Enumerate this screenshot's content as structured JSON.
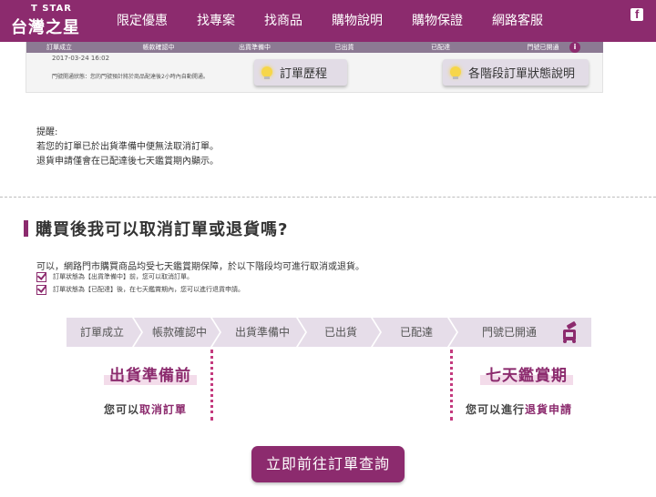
{
  "header": {
    "brand_small": "T STAR",
    "brand_main": "台灣之星",
    "nav": [
      "限定優惠",
      "找專案",
      "找商品",
      "購物說明",
      "購物保證",
      "網路客服"
    ],
    "facebook_icon": "facebook-icon"
  },
  "tracking_card": {
    "steps": [
      "訂單成立",
      "帳款確認中",
      "出貨準備中",
      "已出貨",
      "已配達",
      "門號已開通"
    ],
    "info_icon": "info-icon",
    "date": "2017-03-24 16:02",
    "note": "門號開通狀態：您的門號預計將於商品配達後2小時內自動開通。",
    "history_button": "訂單歷程",
    "stage_button": "各階段訂單狀態說明"
  },
  "reminder": {
    "title": "提醒:",
    "line1": "若您的訂單已於出貨準備中便無法取消訂單。",
    "line2": "退貨申請僅會在已配達後七天鑑賞期內顯示。"
  },
  "section": {
    "title": "購買後我可以取消訂單或退貨嗎?",
    "intro": "可以，網路門市購買商品均受七天鑑賞期保障，於以下階段均可進行取消或退貨。",
    "check1": "訂單狀態為【出貨準備中】前，您可以取消訂單。",
    "check2": "訂單狀態為【已配達】後，在七天鑑賞期內，您可以進行退貨申請。"
  },
  "steps": [
    "訂單成立",
    "帳款確認中",
    "出貨準備中",
    "已出貨",
    "已配達",
    "門號已開通"
  ],
  "highlights": {
    "left_title": "出貨準備前",
    "left_sub_prefix": "您可以",
    "left_sub_accent": "取消訂單",
    "right_title": "七天鑑賞期",
    "right_sub_prefix": "您可以進行",
    "right_sub_accent": "退貨申請"
  },
  "cta": {
    "label": "立即前往訂單查詢"
  },
  "colors": {
    "brand": "#8c2b6e",
    "step_fill": "#e6dde9",
    "highlight_bg": "#f3dcea",
    "dotted_line": "#c43a7e"
  }
}
